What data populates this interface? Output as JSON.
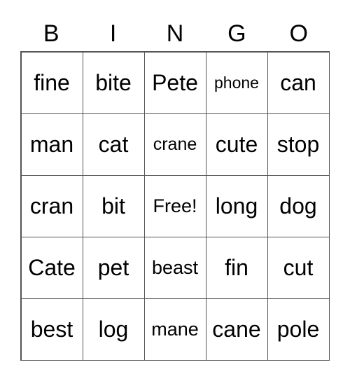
{
  "header": [
    "B",
    "I",
    "N",
    "G",
    "O"
  ],
  "rows": [
    [
      "fine",
      "bite",
      "Pete",
      "phone",
      "can"
    ],
    [
      "man",
      "cat",
      "crane",
      "cute",
      "stop"
    ],
    [
      "cran",
      "bit",
      "Free!",
      "long",
      "dog"
    ],
    [
      "Cate",
      "pet",
      "beast",
      "fin",
      "cut"
    ],
    [
      "best",
      "log",
      "mane",
      "cane",
      "pole"
    ]
  ]
}
